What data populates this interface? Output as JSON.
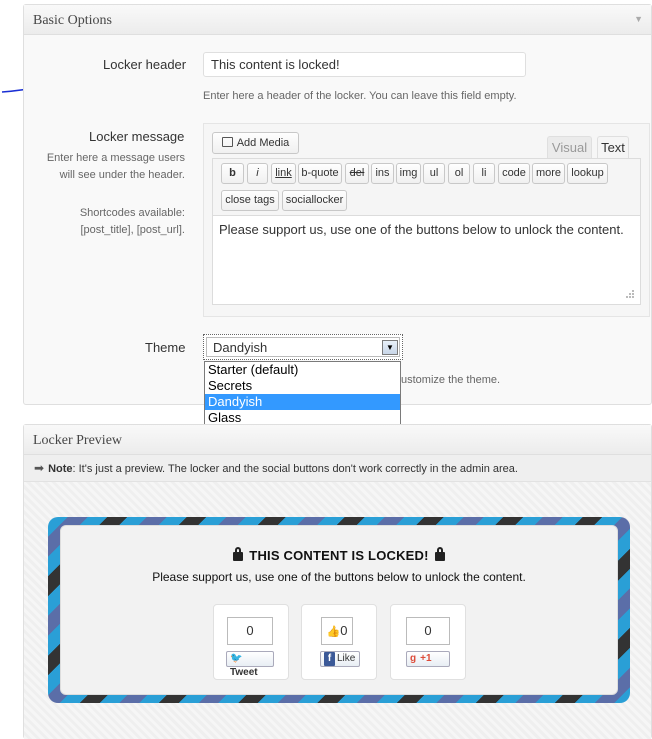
{
  "basic_options": {
    "title": "Basic Options",
    "locker_header": {
      "label": "Locker header",
      "value": "This content is locked!",
      "hint": "Enter here a header of the locker. You can leave this field empty."
    },
    "locker_message": {
      "label": "Locker message",
      "hint_line1": "Enter here a message users",
      "hint_line2": "will see under the header.",
      "shortcodes_line1": "Shortcodes available:",
      "shortcodes_line2": "[post_title], [post_url].",
      "add_media": "Add Media",
      "tab_visual": "Visual",
      "tab_text": "Text",
      "quicktags_row1": [
        "b",
        "i",
        "link",
        "b-quote",
        "del",
        "ins",
        "img",
        "ul",
        "ol",
        "li",
        "code",
        "more",
        "lookup"
      ],
      "quicktags_row2": [
        "close tags",
        "sociallocker"
      ],
      "content": "Please support us, use one of the buttons below to unlock the content."
    },
    "theme": {
      "label": "Theme",
      "selected": "Dandyish",
      "options": [
        "Starter (default)",
        "Secrets",
        "Dandyish",
        "Glass"
      ],
      "hint_partial": "ustomize the theme."
    }
  },
  "locker_preview": {
    "title": "Locker Preview",
    "note_label": "Note",
    "note_text": ": It's just a preview. The locker and the social buttons don't work correctly in the admin area.",
    "locker_title": "THIS CONTENT IS LOCKED!",
    "locker_message": "Please support us, use one of the buttons below to unlock the content.",
    "social": [
      {
        "count": "0",
        "button": "Tweet",
        "network": "twitter"
      },
      {
        "count": "0",
        "button": "Like",
        "network": "facebook"
      },
      {
        "count": "0",
        "button": "+1",
        "network": "google"
      }
    ]
  },
  "colors": {
    "accent_selection": "#3399ff",
    "annotation": "#1a2fd4",
    "frame_blue": "#2a9fd6",
    "frame_purple": "#5b6ea8"
  }
}
